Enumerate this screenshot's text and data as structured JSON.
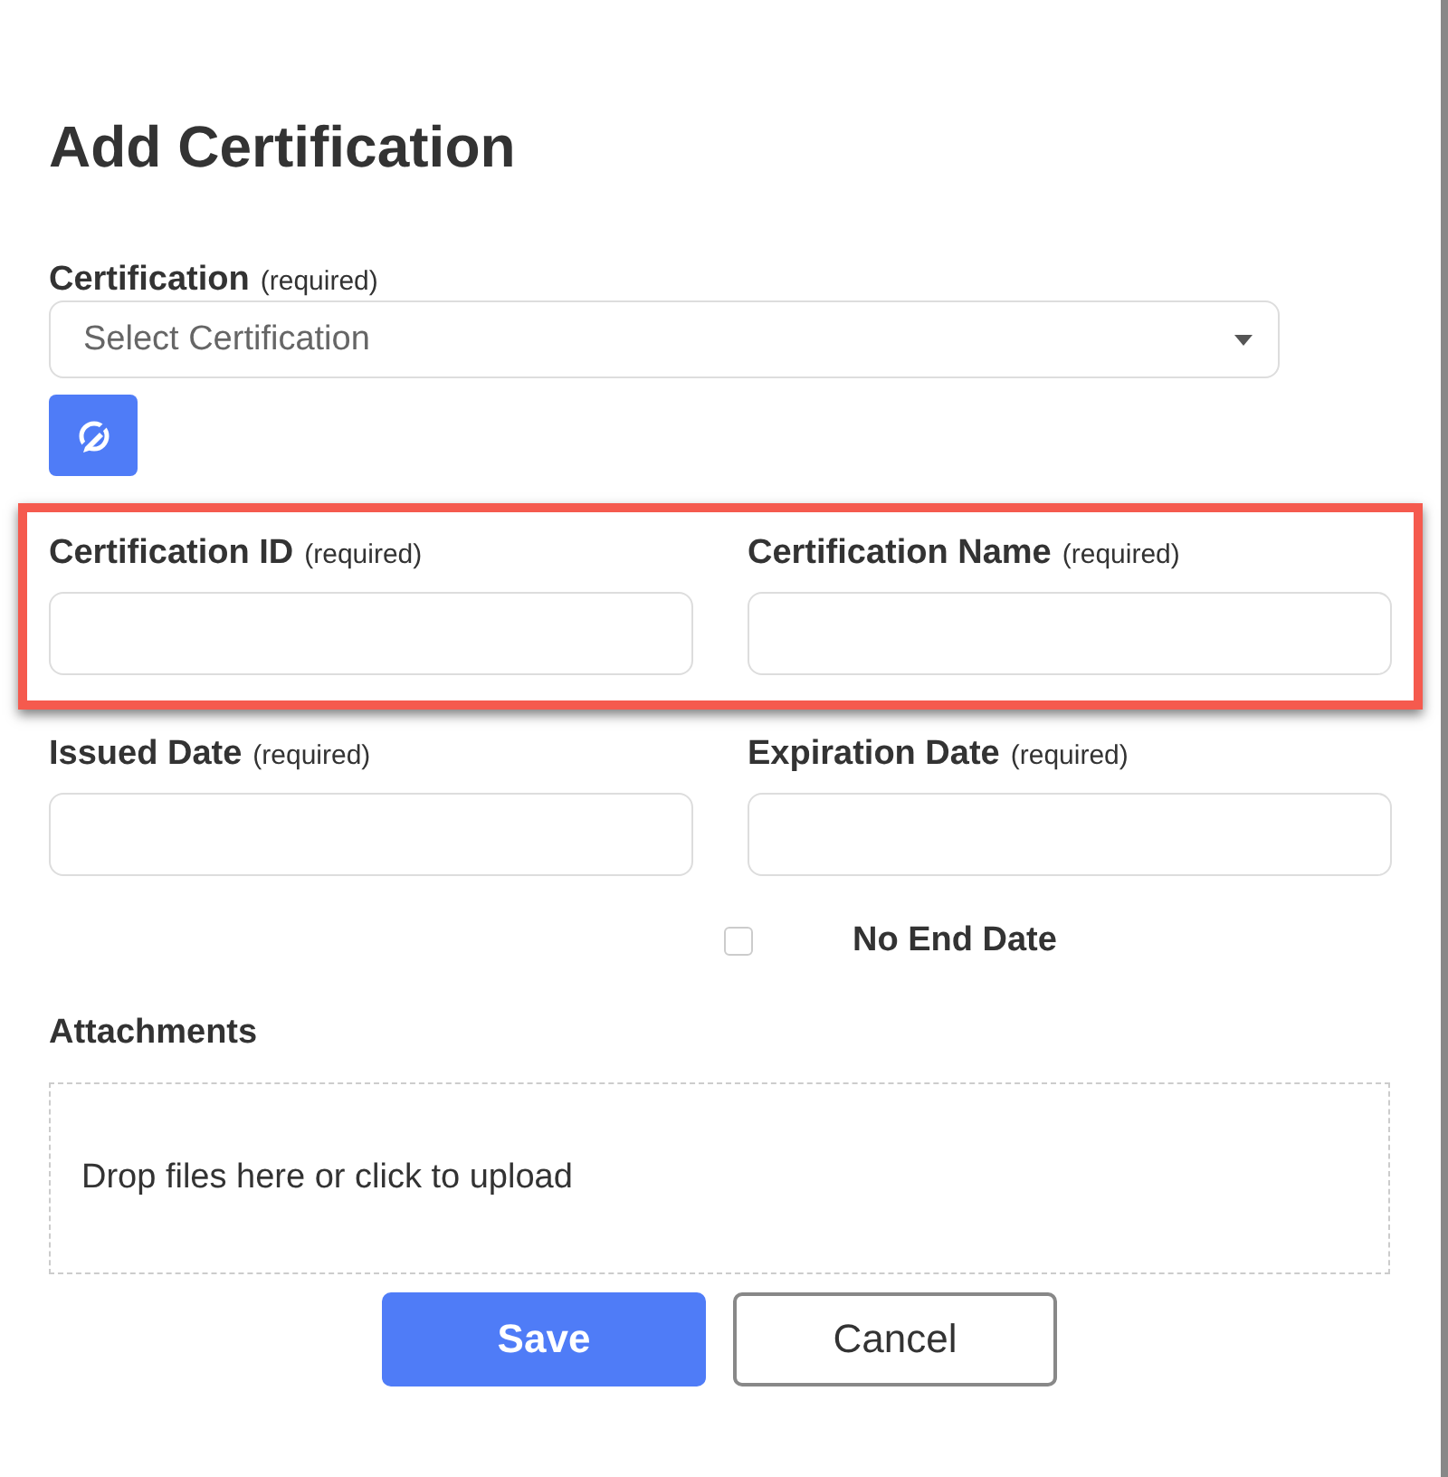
{
  "title": "Add Certification",
  "certification": {
    "label": "Certification",
    "hint": "(required)",
    "placeholder": "Select Certification"
  },
  "highlighted_fields": [
    {
      "label": "Certification ID",
      "hint": "(required)"
    },
    {
      "label": "Certification Name",
      "hint": "(required)"
    }
  ],
  "date_fields": [
    {
      "label": "Issued Date",
      "hint": "(required)"
    },
    {
      "label": "Expiration Date",
      "hint": "(required)"
    }
  ],
  "no_end_date": {
    "label": "No End Date",
    "checked": false
  },
  "attachments": {
    "label": "Attachments",
    "dropzone_text": "Drop files here or click to upload"
  },
  "buttons": [
    {
      "label": "Save",
      "kind": "primary"
    },
    {
      "label": "Cancel",
      "kind": "secondary"
    }
  ]
}
